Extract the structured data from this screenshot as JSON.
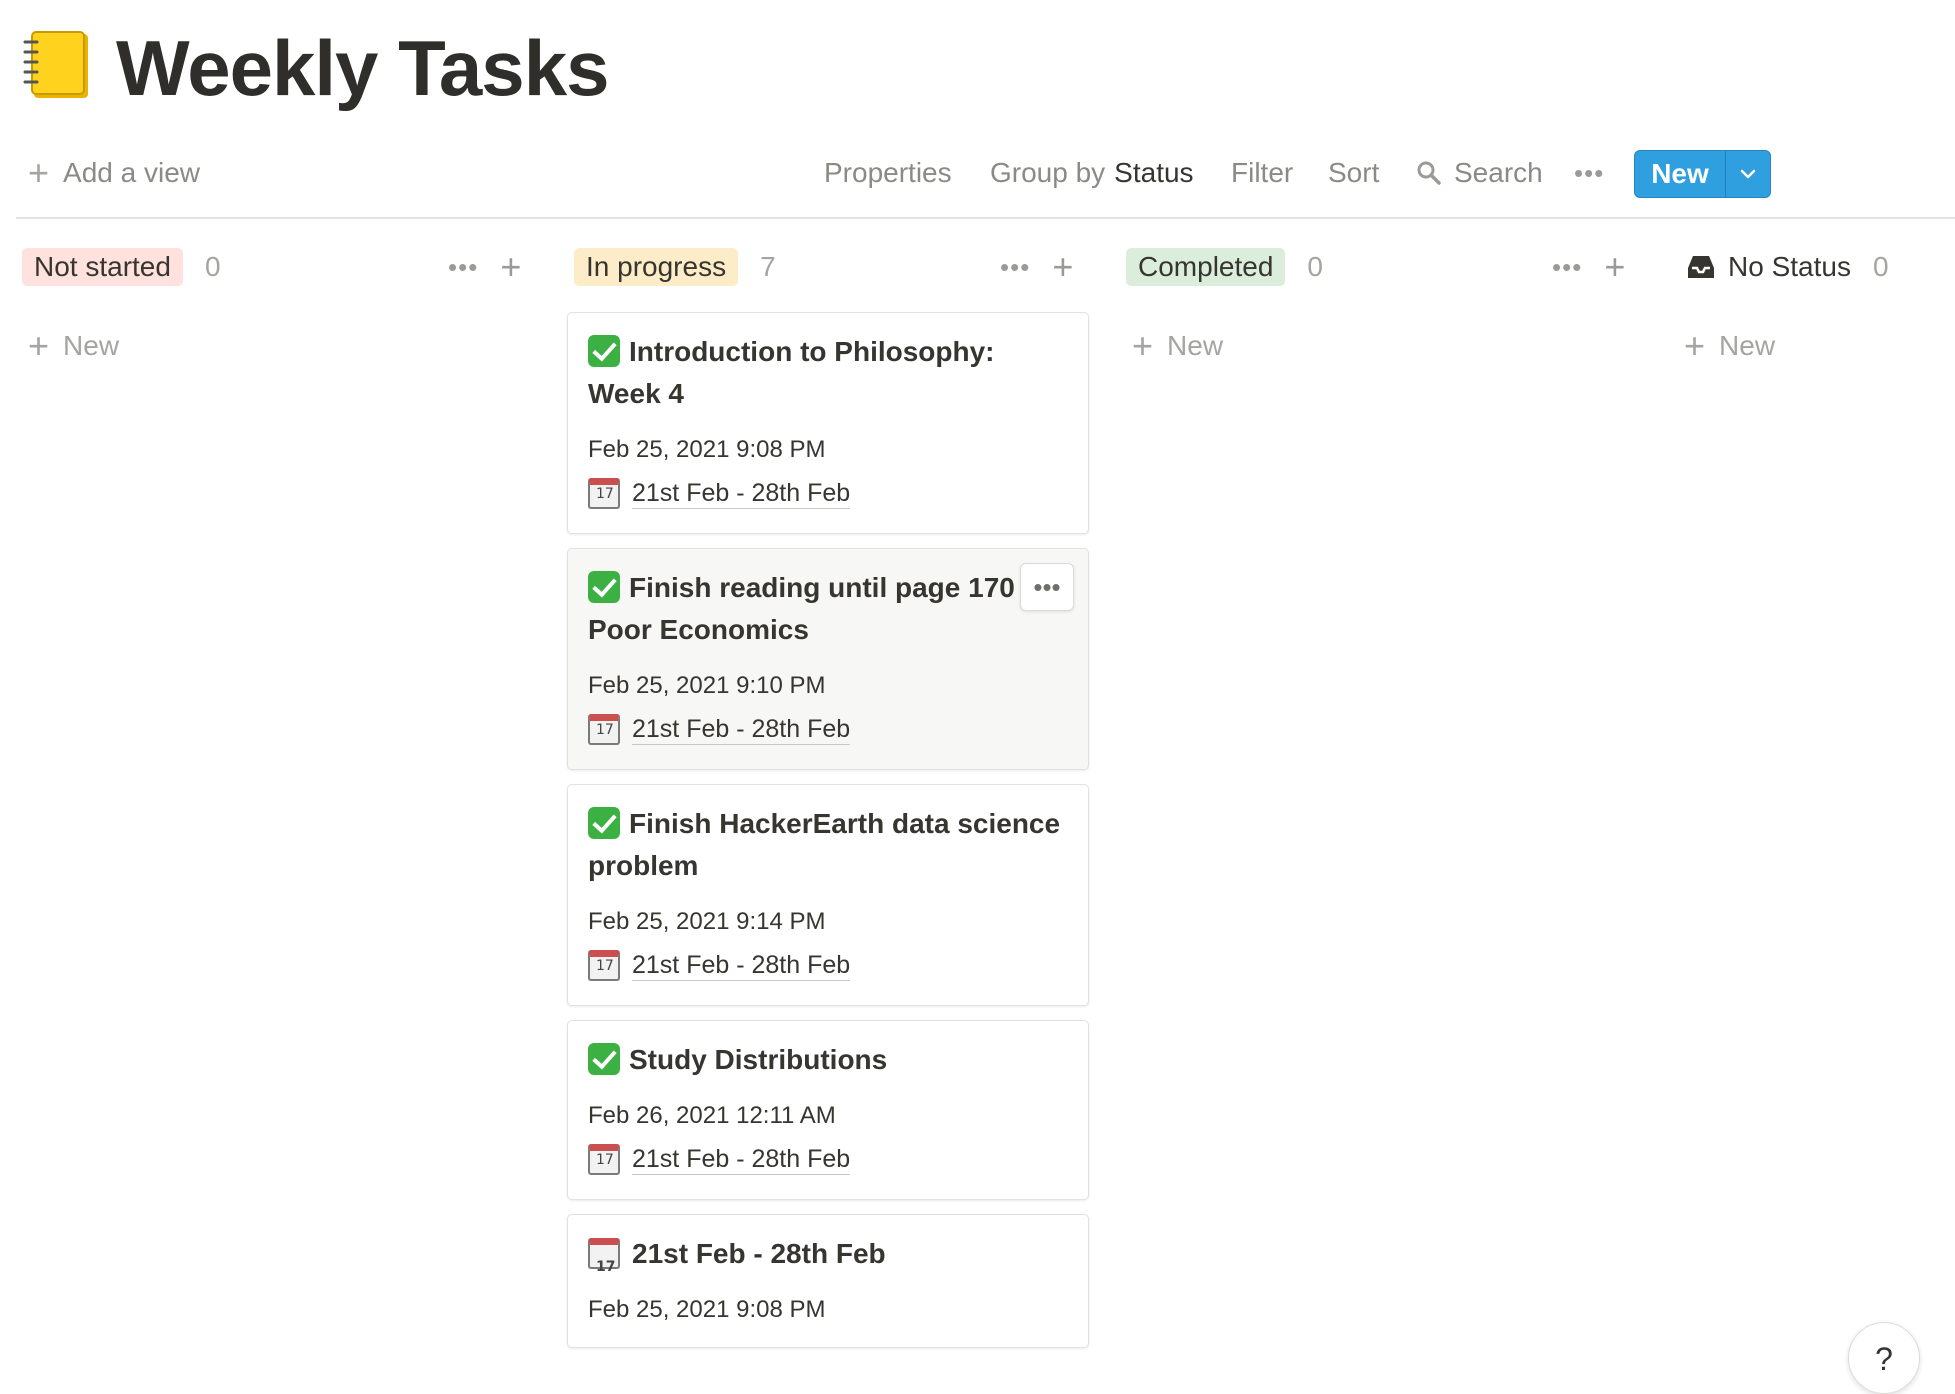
{
  "page": {
    "title": "Weekly Tasks",
    "title_icon": "notebook-icon"
  },
  "toolbar": {
    "add_view_label": "Add a view",
    "properties_label": "Properties",
    "group_by_label": "Group by",
    "group_by_value": "Status",
    "filter_label": "Filter",
    "sort_label": "Sort",
    "search_label": "Search",
    "more_label": "•••",
    "new_label": "New"
  },
  "columns": [
    {
      "label": "Not started",
      "count": "0",
      "color": "#ffe2dd",
      "new_label": "New"
    },
    {
      "label": "In progress",
      "count": "7",
      "color": "#fdecc8",
      "new_label": ""
    },
    {
      "label": "Completed",
      "count": "0",
      "color": "#dbeddb",
      "new_label": "New"
    },
    {
      "label": "No Status",
      "count": "0",
      "color": "#ffffff",
      "new_label": "New"
    }
  ],
  "cards": [
    {
      "icon": "check-icon",
      "title": "Introduction to Philosophy: Week 4",
      "created": "Feb 25, 2021 9:08 PM",
      "week": "21st Feb - 28th Feb"
    },
    {
      "icon": "check-icon",
      "title": "Finish reading until page 170 of Poor Economics",
      "created": "Feb 25, 2021 9:10 PM",
      "week": "21st Feb - 28th Feb"
    },
    {
      "icon": "check-icon",
      "title": "Finish HackerEarth data science problem",
      "created": "Feb 25, 2021 9:14 PM",
      "week": "21st Feb - 28th Feb"
    },
    {
      "icon": "check-icon",
      "title": "Study Distributions",
      "created": "Feb 26, 2021 12:11 AM",
      "week": "21st Feb - 28th Feb"
    },
    {
      "icon": "calendar-icon",
      "title": "21st Feb - 28th Feb",
      "created": "Feb 25, 2021 9:08 PM"
    }
  ],
  "card_menu_label": "•••",
  "help_label": "?",
  "colors": {
    "accent": "#2f9fe0",
    "check": "#3cb043"
  }
}
